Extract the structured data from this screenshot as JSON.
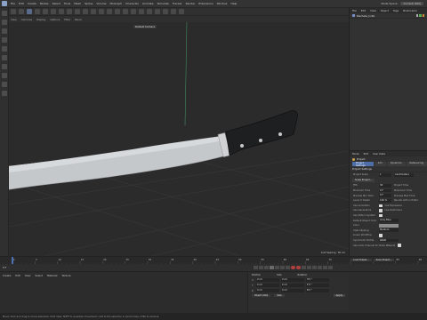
{
  "menubar": {
    "items": [
      "File",
      "Edit",
      "Create",
      "Modes",
      "Select",
      "Tools",
      "Mesh",
      "Spline",
      "Volume",
      "MoGraph",
      "Character",
      "Animate",
      "Simulate",
      "Tracker",
      "Render",
      "Extensions",
      "Window",
      "Help"
    ],
    "right": [
      "Node Space:",
      "Current (Std)"
    ]
  },
  "viewport": {
    "menu": [
      "View",
      "Cameras",
      "Display",
      "Options",
      "Filter",
      "Panel"
    ],
    "camera_label": "Default Camera",
    "stats": "Grid Spacing : 50 cm"
  },
  "object_manager": {
    "tabs": [
      "File",
      "Edit",
      "View",
      "Object",
      "Tags",
      "Bookmarks"
    ],
    "object_name": "Machete_knife",
    "colors": {
      "icon": "#7a8ccc"
    }
  },
  "attributes": {
    "menu": [
      "Mode",
      "Edit",
      "User Data"
    ],
    "title": "Project",
    "subtabs": [
      "Project Settings",
      "Info",
      "Dynamics",
      "Referencing"
    ],
    "section": "Project Settings",
    "fields": [
      {
        "label": "Project Scale",
        "value": "1",
        "unit_label": "Centimeters"
      },
      {
        "label": "FPS",
        "value": "30",
        "right": "Project Time"
      },
      {
        "label": "Minimum Time",
        "value": "0 F",
        "right": "Maximum Time"
      },
      {
        "label": "Preview Min Time",
        "value": "0 F",
        "right": "Preview Max Time"
      },
      {
        "label": "Level of Detail",
        "value": "100 %",
        "right": "Render LOD in Editor"
      },
      {
        "label": "Use Animation",
        "right": "Use Expression"
      },
      {
        "label": "Use Generators",
        "right": "Use Deformers"
      },
      {
        "label": "Use Motion System"
      },
      {
        "label": "Default Object Color",
        "value": "Gray Blue"
      },
      {
        "label": "Color"
      },
      {
        "label": "View Clipping",
        "value": "Medium"
      },
      {
        "label": "Linear Workflow"
      },
      {
        "label": "Input Color Profile",
        "value": "sRGB"
      }
    ],
    "scale_button": "Scale Project...",
    "load_preset": "Load Preset...",
    "save_preset": "Save Preset...",
    "use_color_channel": "Use Color Channel for Node Material"
  },
  "timeline": {
    "ticks": [
      "0",
      "5",
      "10",
      "15",
      "20",
      "25",
      "30",
      "35",
      "40",
      "45",
      "50",
      "55",
      "60",
      "65",
      "70",
      "75",
      "80",
      "85",
      "90"
    ],
    "current_frame": "0 F"
  },
  "materials": {
    "menu": [
      "Create",
      "Edit",
      "View",
      "Select",
      "Material",
      "Texture"
    ]
  },
  "coordinates": {
    "headers": [
      "Position",
      "Size",
      "Rotation"
    ],
    "rows": [
      {
        "axis": "X",
        "pos": "0 cm",
        "size": "0 cm",
        "rot": "H 0 °"
      },
      {
        "axis": "Y",
        "pos": "0 cm",
        "size": "0 cm",
        "rot": "P 0 °"
      },
      {
        "axis": "Z",
        "pos": "0 cm",
        "size": "0 cm",
        "rot": "B 0 °"
      }
    ],
    "mode": "Object (Rel)",
    "size_mode": "Size",
    "apply": "Apply"
  },
  "status": "Move: Click and drag to move elements. Hold down SHIFT to quantize movement / add to the selection in point mode, CTRL to remove."
}
